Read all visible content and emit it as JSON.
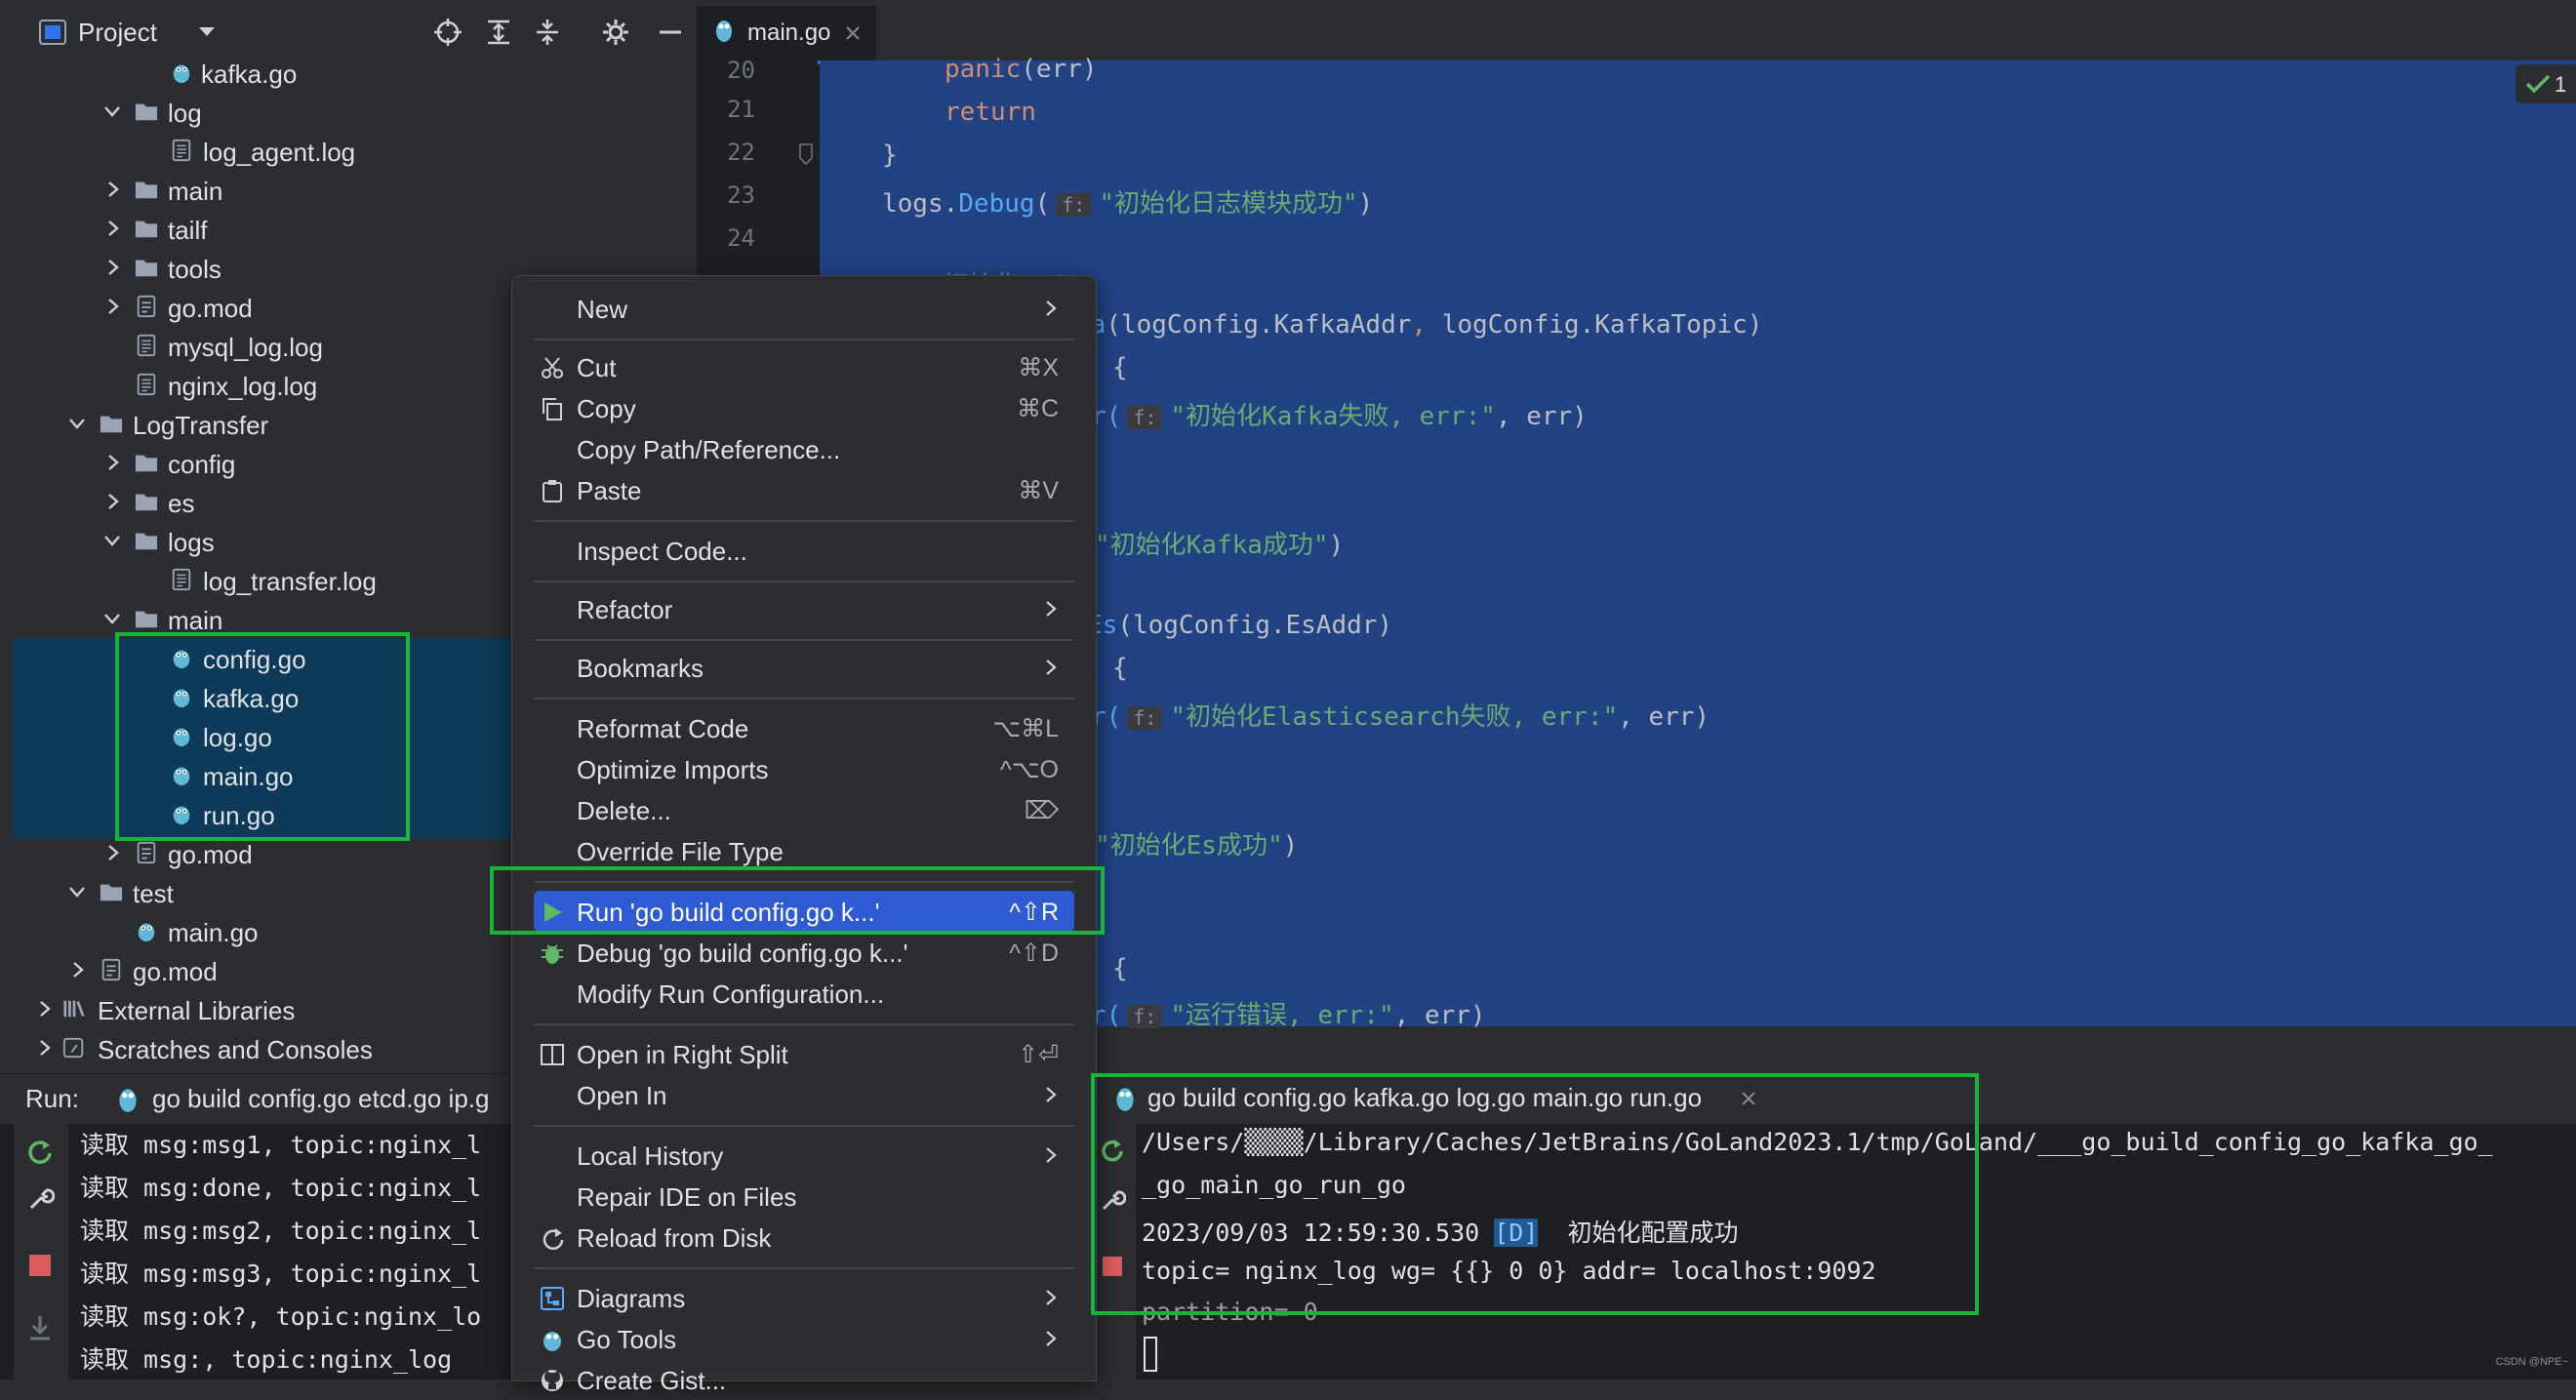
{
  "project": {
    "title": "Project",
    "tree": [
      {
        "label": "kafka.go",
        "kind": "go"
      },
      {
        "label": "log",
        "kind": "folder",
        "state": "open"
      },
      {
        "label": "log_agent.log",
        "kind": "file"
      },
      {
        "label": "main",
        "kind": "folder",
        "state": "closed"
      },
      {
        "label": "tailf",
        "kind": "folder",
        "state": "closed"
      },
      {
        "label": "tools",
        "kind": "folder",
        "state": "closed"
      },
      {
        "label": "go.mod",
        "kind": "mod",
        "state": "closed"
      },
      {
        "label": "mysql_log.log",
        "kind": "file"
      },
      {
        "label": "nginx_log.log",
        "kind": "file"
      },
      {
        "label": "LogTransfer",
        "kind": "folder",
        "state": "open"
      },
      {
        "label": "config",
        "kind": "folder",
        "state": "closed"
      },
      {
        "label": "es",
        "kind": "folder",
        "state": "closed"
      },
      {
        "label": "logs",
        "kind": "folder",
        "state": "open"
      },
      {
        "label": "log_transfer.log",
        "kind": "file"
      },
      {
        "label": "main",
        "kind": "folder",
        "state": "open"
      },
      {
        "label": "config.go",
        "kind": "go"
      },
      {
        "label": "kafka.go",
        "kind": "go"
      },
      {
        "label": "log.go",
        "kind": "go"
      },
      {
        "label": "main.go",
        "kind": "go"
      },
      {
        "label": "run.go",
        "kind": "go"
      },
      {
        "label": "go.mod",
        "kind": "mod",
        "state": "closed"
      },
      {
        "label": "test",
        "kind": "folder",
        "state": "open"
      },
      {
        "label": "main.go",
        "kind": "go"
      },
      {
        "label": "go.mod",
        "kind": "mod",
        "state": "closed"
      },
      {
        "label": "External Libraries",
        "kind": "lib",
        "state": "closed"
      },
      {
        "label": "Scratches and Consoles",
        "kind": "scratch",
        "state": "closed"
      }
    ]
  },
  "editor": {
    "tab": "main.go",
    "badge": "1",
    "line_numbers": [
      "20",
      "21",
      "22",
      "23",
      "24"
    ],
    "code": {
      "l20a": "panic",
      "l20b": "(err)",
      "l21": "return",
      "l22": "}",
      "l23a": "logs.",
      "l23b": "Debug",
      "l23hint": "f:",
      "l23str": "\"初始化日志模块成功\"",
      "l23c": ")",
      "l26a": "//  初始化Kafka",
      "l27a": "ka",
      "l27b": "(logConfig.KafkaAddr",
      "l27c": ", ",
      "l27d": "logConfig.KafkaTopic)",
      "l28": "{",
      "l29a": "r(",
      "l29hint": "f:",
      "l29str": "\"初始化Kafka失败, err:\"",
      "l29b": ", err)",
      "l32str": "\"初始化Kafka成功\"",
      "l32b": ")",
      "l34a": "Es",
      "l34b": "(logConfig.EsAddr)",
      "l35": "{",
      "l36a": "r(",
      "l36hint": "f:",
      "l36str": "\"初始化Elasticsearch失败, err:\"",
      "l36b": ", err)",
      "l39str": "\"初始化Es成功\"",
      "l39b": ")",
      "l43": "{",
      "l44a": "r(",
      "l44hint": "f:",
      "l44str": "\"运行错误, err:\"",
      "l44b": ", err)"
    }
  },
  "context_menu": {
    "items": [
      {
        "label": "New",
        "shortcut": "",
        "submenu": true
      },
      {
        "label": "Cut",
        "shortcut": "⌘X",
        "icon": "scissors-icon"
      },
      {
        "label": "Copy",
        "shortcut": "⌘C",
        "icon": "copy-icon"
      },
      {
        "label": "Copy Path/Reference...",
        "shortcut": ""
      },
      {
        "label": "Paste",
        "shortcut": "⌘V",
        "icon": "clipboard-icon"
      },
      {
        "label": "Inspect Code...",
        "shortcut": ""
      },
      {
        "label": "Refactor",
        "shortcut": "",
        "submenu": true
      },
      {
        "label": "Bookmarks",
        "shortcut": "",
        "submenu": true
      },
      {
        "label": "Reformat Code",
        "shortcut": "⌥⌘L"
      },
      {
        "label": "Optimize Imports",
        "shortcut": "^⌥O"
      },
      {
        "label": "Delete...",
        "shortcut": "⌦"
      },
      {
        "label": "Override File Type",
        "shortcut": ""
      },
      {
        "label": "Run 'go build config.go k...'",
        "shortcut": "^⇧R",
        "icon": "run-icon",
        "active": true
      },
      {
        "label": "Debug 'go build config.go k...'",
        "shortcut": "^⇧D",
        "icon": "debug-icon"
      },
      {
        "label": "Modify Run Configuration...",
        "shortcut": ""
      },
      {
        "label": "Open in Right Split",
        "shortcut": "⇧⏎",
        "icon": "split-icon"
      },
      {
        "label": "Open In",
        "shortcut": "",
        "submenu": true
      },
      {
        "label": "Local History",
        "shortcut": "",
        "submenu": true
      },
      {
        "label": "Repair IDE on Files",
        "shortcut": ""
      },
      {
        "label": "Reload from Disk",
        "shortcut": "",
        "icon": "reload-icon"
      },
      {
        "label": "Diagrams",
        "shortcut": "",
        "submenu": true,
        "icon": "diagram-icon"
      },
      {
        "label": "Go Tools",
        "shortcut": "",
        "submenu": true,
        "icon": "gopher-icon"
      },
      {
        "label": "Create Gist...",
        "shortcut": "",
        "icon": "github-icon"
      }
    ]
  },
  "run": {
    "label": "Run:",
    "left_tab": "go build config.go etcd.go ip.g",
    "right_tab": "go build config.go kafka.go log.go main.go run.go",
    "left_console": [
      "读取 msg:msg1, topic:nginx_l",
      "读取 msg:done, topic:nginx_l",
      "读取 msg:msg2, topic:nginx_l",
      "读取 msg:msg3, topic:nginx_l",
      "读取 msg:ok?, topic:nginx_lo",
      "读取 msg:, topic:nginx_log"
    ],
    "right_console": {
      "line1": "/Users/▒▒▒▒/Library/Caches/JetBrains/GoLand2023.1/tmp/GoLand/___go_build_config_go_kafka_go_",
      "line2": "_go_main_go_run_go",
      "line3_time": "2023/09/03 12:59:30.530",
      "line3_level": "[D]",
      "line3_msg": "初始化配置成功",
      "line4": "topic= nginx_log wg= {{} 0 0} addr= localhost:9092",
      "line5": "partition= 0"
    }
  },
  "watermark": "CSDN @NPE~",
  "colors": {
    "accent": "#2e5bd4",
    "highlight_box": "#19b53a",
    "selection": "#214283"
  }
}
